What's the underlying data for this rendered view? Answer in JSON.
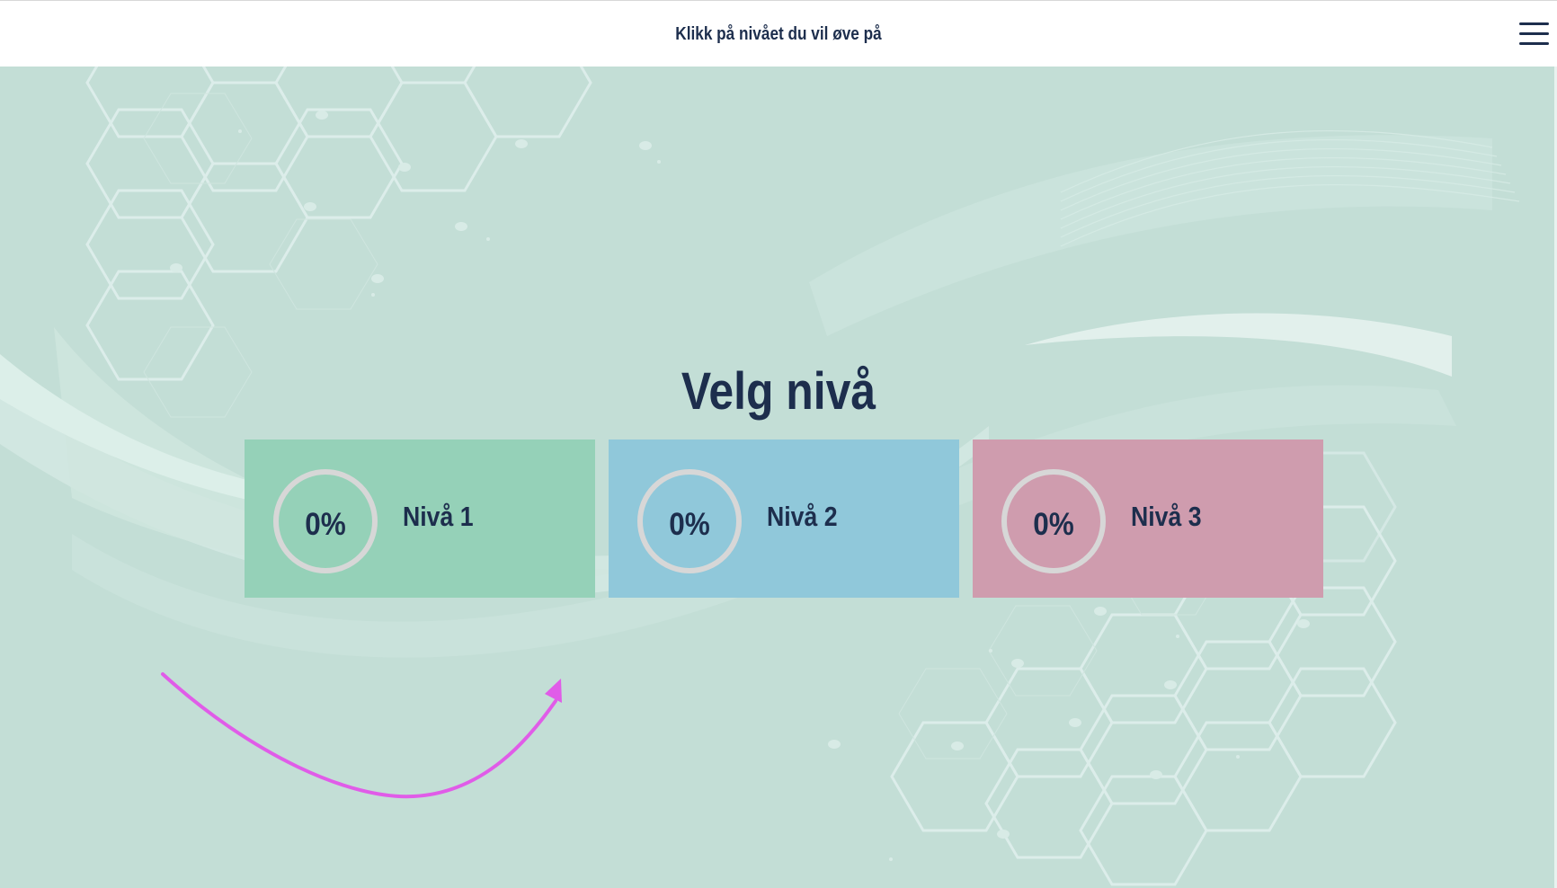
{
  "header": {
    "title": "Klikk på nivået du vil øve på",
    "menu_icon": "hamburger-menu-icon"
  },
  "main": {
    "heading": "Velg nivå",
    "levels": [
      {
        "label": "Nivå 1",
        "progress_text": "0%",
        "progress": 0,
        "color": "#95d1b8"
      },
      {
        "label": "Nivå 2",
        "progress_text": "0%",
        "progress": 0,
        "color": "#90c8da"
      },
      {
        "label": "Nivå 3",
        "progress_text": "0%",
        "progress": 0,
        "color": "#cf9cae"
      }
    ],
    "arrow_icon": "curved-arrow-icon"
  },
  "colors": {
    "text": "#1d2e4d",
    "background": "#c3ded6",
    "ring": "#d7d7d7",
    "arrow": "#e05ce8"
  }
}
